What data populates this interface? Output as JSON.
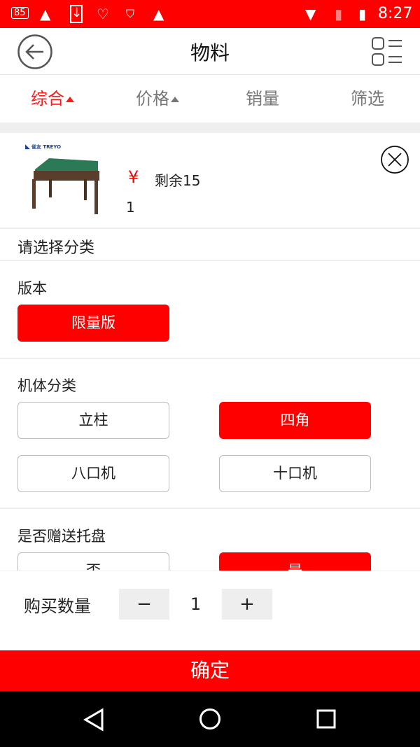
{
  "status_bar": {
    "battery_badge": "85",
    "time": "8:27",
    "icons": [
      "battery-85-icon",
      "warning-icon",
      "download-icon",
      "heart-icon",
      "shield-icon",
      "warning-icon",
      "wifi-icon",
      "no-sim-icon",
      "battery-icon"
    ]
  },
  "header": {
    "title": "物料",
    "back_icon": "back-arrow-icon",
    "menu_icon": "list-view-icon"
  },
  "tabs": [
    {
      "label": "综合",
      "active": true,
      "sort": true
    },
    {
      "label": "价格",
      "sort": true
    },
    {
      "label": "销量"
    },
    {
      "label": "筛选"
    }
  ],
  "product": {
    "brand": "雀友 TREYO",
    "price_symbol": "¥",
    "stock": "剩余15",
    "price": "1",
    "close_icon": "close-circle-icon"
  },
  "prompt": "请选择分类",
  "groups": [
    {
      "label": "版本",
      "options": [
        {
          "label": "限量版",
          "selected": true
        }
      ]
    },
    {
      "label": "机体分类",
      "options": [
        {
          "label": "立柱",
          "selected": false
        },
        {
          "label": "四角",
          "selected": true
        },
        {
          "label": "八口机",
          "selected": false
        },
        {
          "label": "十口机",
          "selected": false
        }
      ]
    },
    {
      "label": "是否赠送托盘",
      "options": [
        {
          "label": "否",
          "selected": false
        },
        {
          "label": "是",
          "selected": true
        }
      ]
    }
  ],
  "quantity": {
    "label": "购买数量",
    "minus": "−",
    "value": "1",
    "plus": "+"
  },
  "confirm": "确定",
  "colors": {
    "accent": "#ff0000"
  }
}
